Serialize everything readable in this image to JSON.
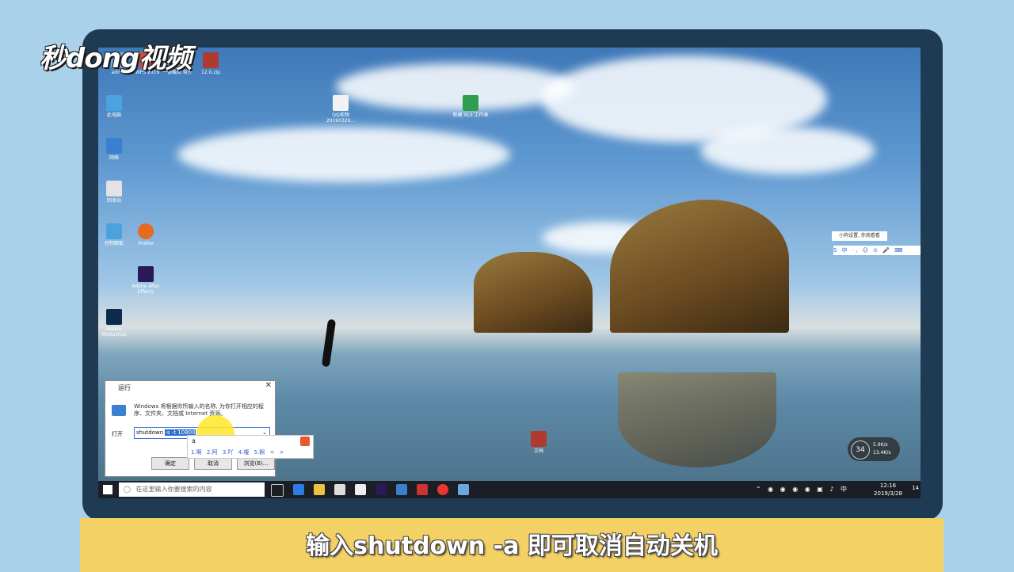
{
  "logo": {
    "text": "秒dong视频"
  },
  "desktop": {
    "icons": [
      {
        "label": "admin",
        "color": "#7aa7d6"
      },
      {
        "label": "WPS 2019",
        "color": "#d04b3b"
      },
      {
        "label": "一键截图 软件",
        "color": "#e3e3e3"
      },
      {
        "label": "12.0.zip",
        "color": "#b03a2e"
      },
      {
        "label": "此电脑",
        "color": "#4aa3df"
      },
      {
        "label": "回收站",
        "color": "#e3e3e3"
      },
      {
        "label": "网络",
        "color": "#3a7fd0"
      },
      {
        "label": "控制面板",
        "color": "#4aa3df"
      },
      {
        "label": "Firefox",
        "color": "#e66a1f"
      },
      {
        "label": "Adobe After Effects",
        "color": "#2a1a5a"
      },
      {
        "label": "Adobe Photoshop",
        "color": "#0b2a4d"
      },
      {
        "label": "QQ视频 20190326...",
        "color": "#f2f2f2"
      },
      {
        "label": "新建 XLS 工作表",
        "color": "#2f9e4f"
      },
      {
        "label": "文档",
        "color": "#b03a2e"
      }
    ],
    "ime_tip": "小狗设置, 你我看看",
    "ime_bar": "S 中 ·, ☺ ⊙ 🎤 ⌨",
    "speed": {
      "percent": "34",
      "up": "5.9K/s",
      "down": "13.4K/s"
    }
  },
  "run_dialog": {
    "title": "运行",
    "close": "✕",
    "description": "Windows 将根据你所输入的名称, 为你打开相应的程序、文件夹、文档或 Internet 资源。",
    "open_label": "打开",
    "input_value": "shutdown",
    "input_selected": "-s -t 10800",
    "ok": "确定",
    "cancel": "取消",
    "browse": "浏览(B)..."
  },
  "ime": {
    "composition": "a",
    "candidates": "1.啊 2.阿 3.吖 4.嗄 5.锕 < >"
  },
  "taskbar": {
    "search_placeholder": "在这里输入你要搜索的内容",
    "time": "12:16",
    "date": "2019/3/28",
    "lang": "中",
    "notifications": "14"
  },
  "caption": "输入shutdown -a 即可取消自动关机"
}
